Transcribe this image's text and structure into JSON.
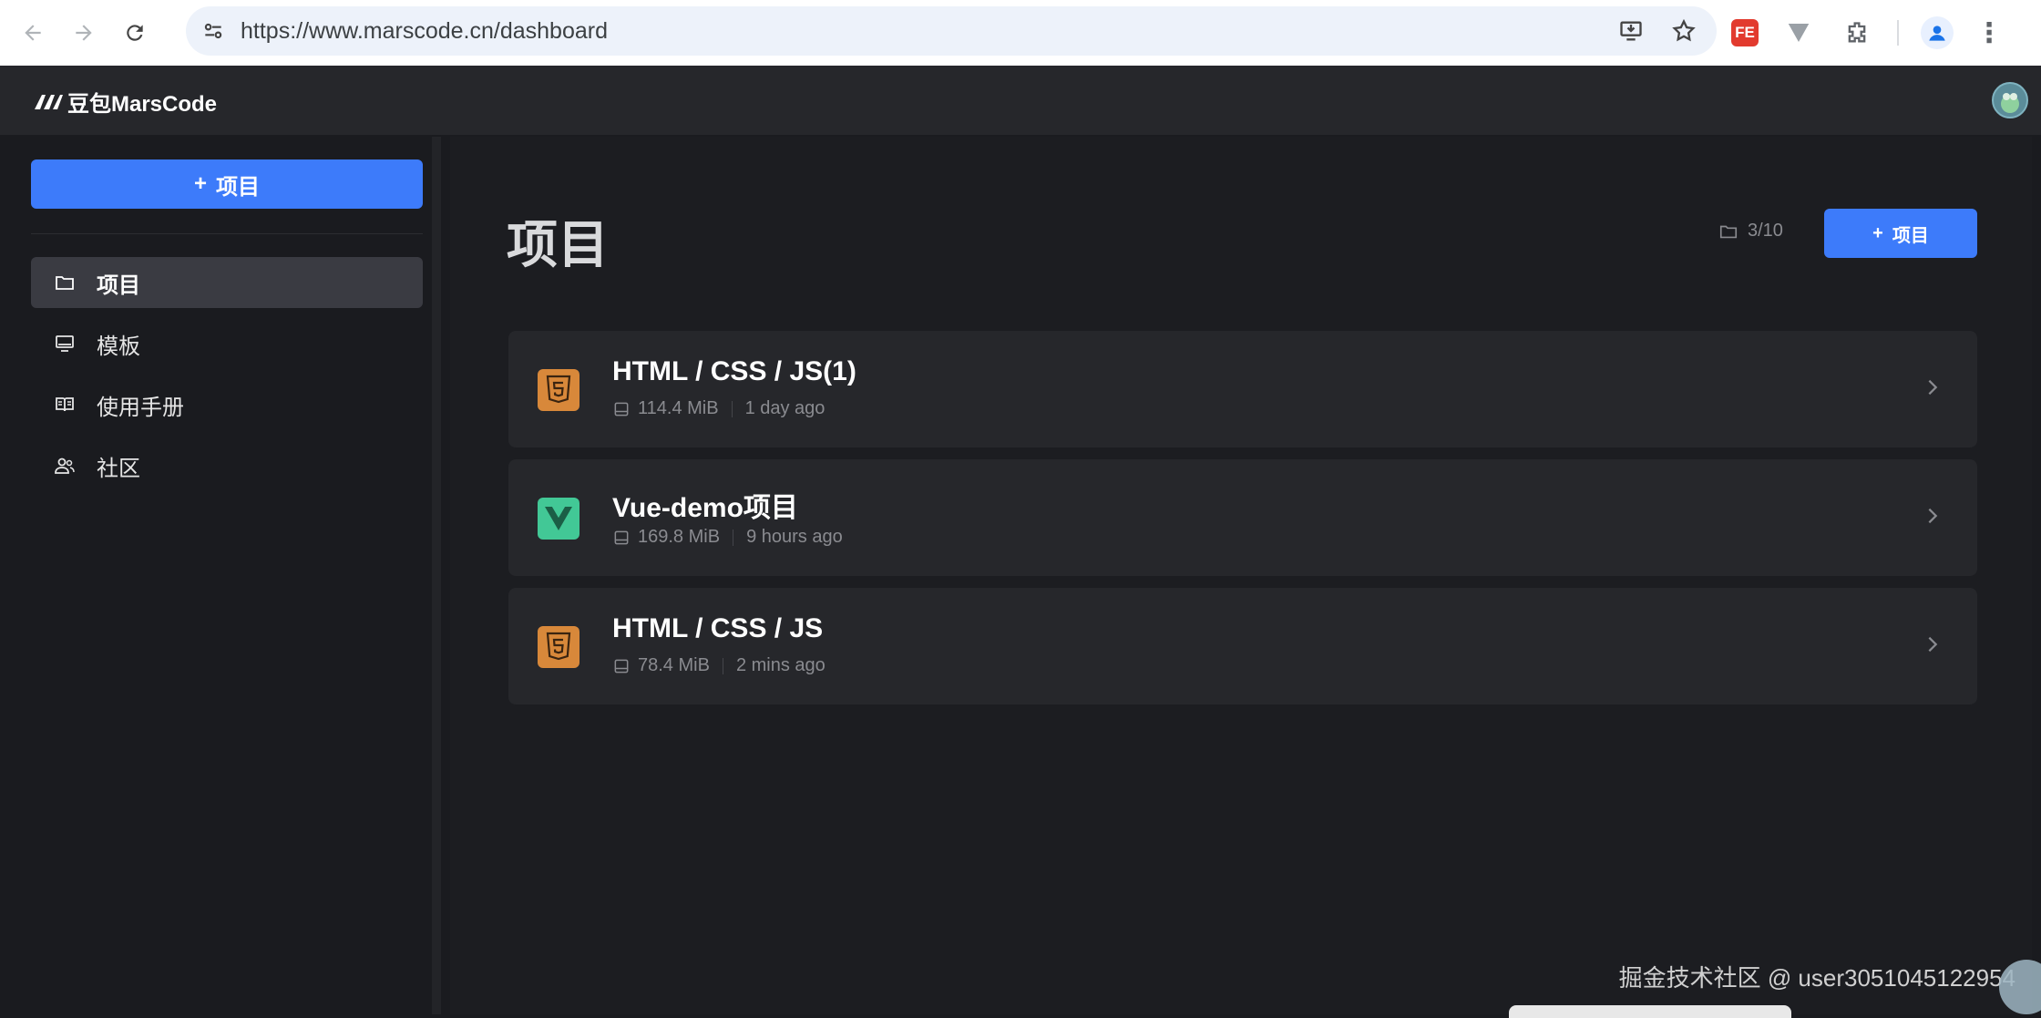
{
  "browser": {
    "url": "https://www.marscode.cn/dashboard",
    "extensions": [
      "FE",
      "V"
    ]
  },
  "app": {
    "logo_text": "豆包MarsCode"
  },
  "sidebar": {
    "new_button_label": "项目",
    "items": [
      {
        "label": "项目",
        "icon": "folder-icon",
        "active": true
      },
      {
        "label": "模板",
        "icon": "monitor-icon",
        "active": false
      },
      {
        "label": "使用手册",
        "icon": "book-icon",
        "active": false
      },
      {
        "label": "社区",
        "icon": "users-icon",
        "active": false
      }
    ]
  },
  "main": {
    "title": "项目",
    "quota": "3/10",
    "new_button_label": "项目",
    "projects": [
      {
        "name": "HTML / CSS / JS(1)",
        "size": "114.4 MiB",
        "time": "1 day ago",
        "icon": "html5-icon"
      },
      {
        "name": "Vue-demo项目",
        "size": "169.8 MiB",
        "time": "9 hours ago",
        "icon": "vue-icon"
      },
      {
        "name": "HTML / CSS / JS",
        "size": "78.4 MiB",
        "time": "2 mins ago",
        "icon": "html5-icon"
      }
    ]
  },
  "watermark": "掘金技术社区 @ user3051045122954",
  "colors": {
    "accent": "#3d7bfa",
    "sidebar_active": "#3a3b42",
    "card_bg": "#26272b",
    "html_icon": "#d8883a",
    "vue_icon": "#42c896"
  }
}
